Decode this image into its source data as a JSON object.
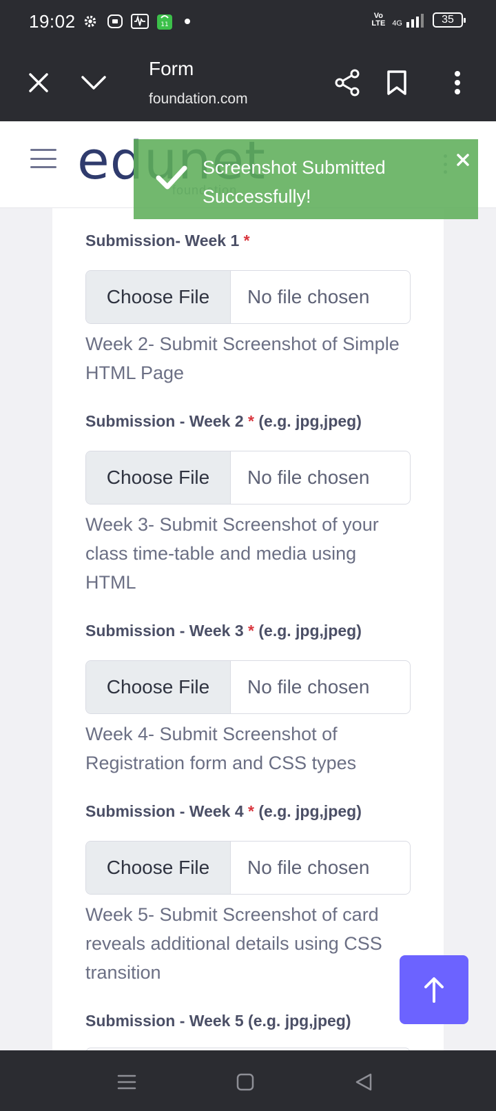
{
  "status_bar": {
    "time": "19:02",
    "network": "4G",
    "volte": "Vo LTE",
    "battery": "35"
  },
  "browser": {
    "title": "Form",
    "url": "foundation.com"
  },
  "site": {
    "logo": "edunet",
    "logo_sub": "foundation"
  },
  "form": {
    "clipped_text": "Screenshot",
    "choose_label": "Choose File",
    "no_file_label": "No file chosen",
    "weeks": [
      {
        "label": "Submission- Week 1",
        "required": "*",
        "hint": ""
      },
      {
        "desc": "Week 2- Submit Screenshot of Simple HTML Page",
        "label": "Submission - Week 2",
        "required": "*",
        "hint": "(e.g. jpg,jpeg)"
      },
      {
        "desc": "Week 3- Submit Screenshot of your class time-table and media using HTML",
        "label": "Submission - Week 3",
        "required": "*",
        "hint": "(e.g. jpg,jpeg)"
      },
      {
        "desc": "Week 4- Submit Screenshot of Registration form and CSS types",
        "label": "Submission - Week 4",
        "required": "*",
        "hint": "(e.g. jpg,jpeg)"
      },
      {
        "desc": "Week 5- Submit Screenshot of card reveals additional details using CSS transition",
        "label": "Submission - Week 5",
        "hint": "(e.g. jpg,jpeg)"
      }
    ]
  },
  "toast": {
    "message": "Screenshot Submitted Successfully!",
    "color": "#5eae5a"
  },
  "accent_color": "#6c63ff"
}
